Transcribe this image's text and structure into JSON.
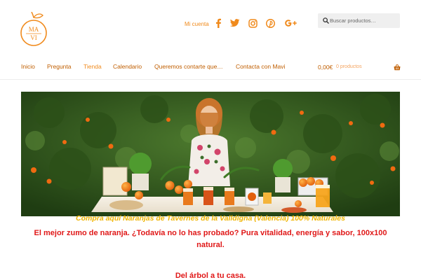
{
  "header": {
    "logo_text_line1": "MA",
    "logo_text_line2": "VI",
    "account_label": "Mi cuenta",
    "social_icons": [
      "facebook-icon",
      "twitter-icon",
      "instagram-icon",
      "pinterest-icon",
      "google-plus-icon"
    ],
    "search": {
      "placeholder": "Buscar productos…",
      "value": ""
    }
  },
  "nav": {
    "items": [
      {
        "label": "Inicio"
      },
      {
        "label": "Pregunta"
      },
      {
        "label": "Tienda"
      },
      {
        "label": "Calendario"
      },
      {
        "label": "Queremos contarte que…"
      },
      {
        "label": "Contacta con Mavi"
      }
    ],
    "active": "Tienda"
  },
  "cart": {
    "total": "0,00€",
    "count": "0 productos"
  },
  "hero": {
    "alt": "Mujer sonriente detrás de una mesa con naranjas, zumos y macetas en un naranjal"
  },
  "content": {
    "tagline": "Compra aquí Naranjas de Tavernes de la Valldigna (Valencia) 100% Naturales",
    "headline": "El mejor zumo de naranja. ¿Todavía no lo has probado?  Pura vitalidad, energía y sabor, 100x100 natural.",
    "subline": "Del árbol a tu casa."
  },
  "colors": {
    "brand_orange": "#f08a1c",
    "nav_text": "#c05e00",
    "headline_red": "#e01818",
    "tagline_yellow": "#f0b400"
  }
}
